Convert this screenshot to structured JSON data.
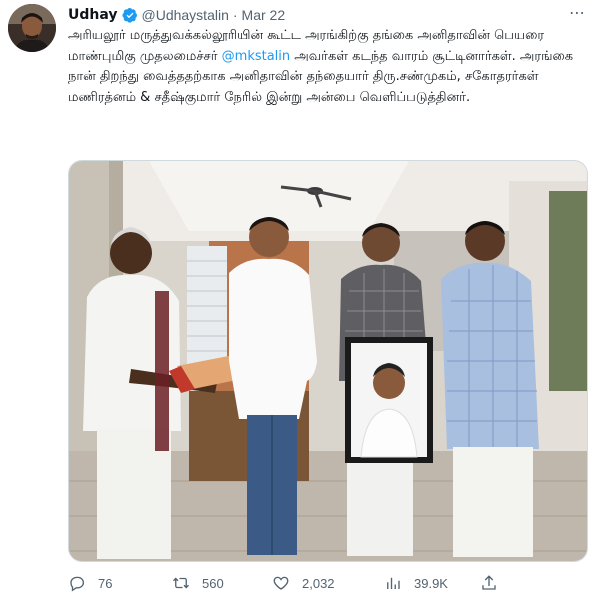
{
  "tweet": {
    "author_name": "Udhay",
    "handle": "@Udhaystalin",
    "separator": "·",
    "date": "Mar 22",
    "more_icon": "more-dots-icon",
    "text_before_mention": "அரியலூர் மருத்துவக்கல்லூரியின் கூட்ட அரங்கிற்கு தங்கை அனிதாவின் பெயரை மாண்புமிகு முதலமைச்சர் ",
    "mention": "@mkstalin",
    "text_after_mention": " அவர்கள் கடந்த வாரம் சூட்டினார்கள். அரங்கை நான் திறந்து வைத்ததற்காக அனிதாவின் தந்தையார் திரு.சண்முகம், சகோதரர்கள் மணிரத்னம் & சதீஷ்குமார் நேரில் இன்று அன்பை வெளிப்படுத்தினர்."
  },
  "actions": {
    "replies": "76",
    "retweets": "560",
    "likes": "2,032",
    "views": "39.9K"
  },
  "colors": {
    "verified": "#1d9bf0",
    "mention": "#1d9bf0",
    "meta_text": "#536471"
  }
}
